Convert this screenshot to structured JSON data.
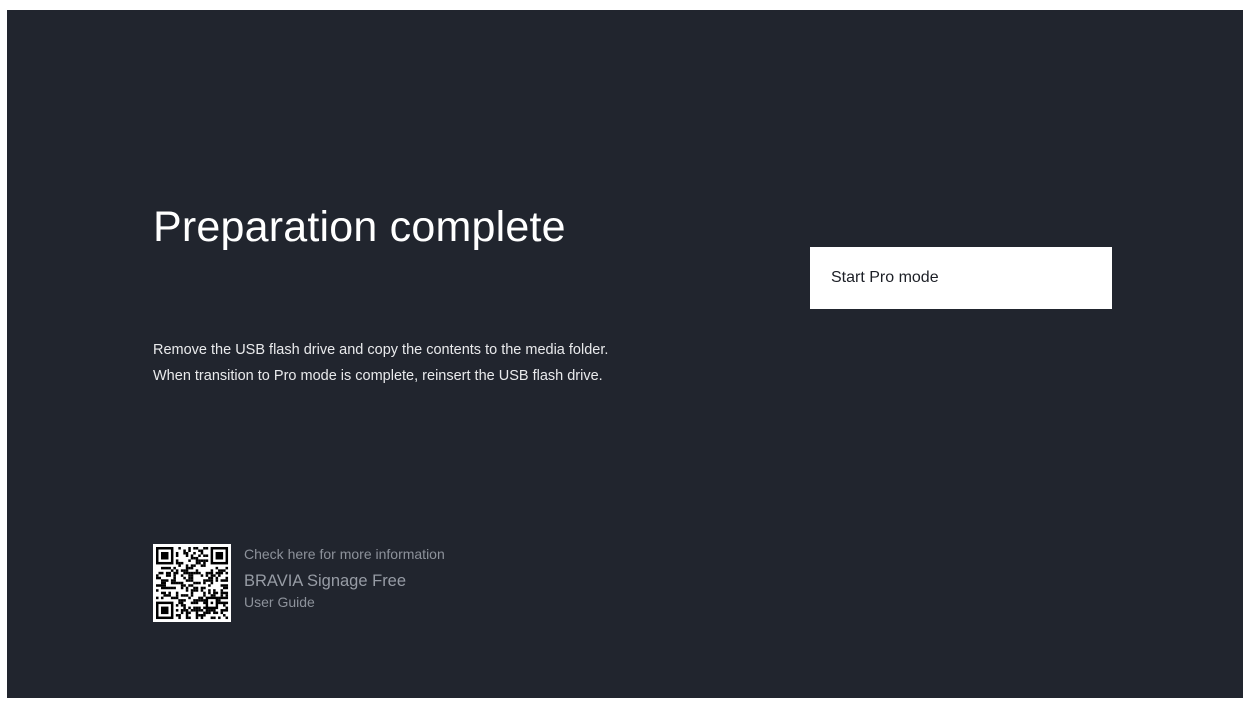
{
  "screen": {
    "title": "Preparation complete",
    "body": [
      "Remove the USB flash drive and copy the contents to the media folder.",
      "When transition to Pro mode is complete, reinsert the USB flash drive."
    ],
    "primary_action": {
      "label": "Start Pro mode"
    },
    "info": {
      "line1": "Check here for more information",
      "line2": "BRAVIA Signage Free",
      "line3": "User Guide"
    }
  },
  "icons": {
    "qr": "qr-code-icon"
  },
  "colors": {
    "background": "#21252e",
    "button_background": "#ffffff",
    "button_text": "#1c1f26",
    "text_primary": "#ffffff",
    "text_secondary": "#8d929b"
  }
}
